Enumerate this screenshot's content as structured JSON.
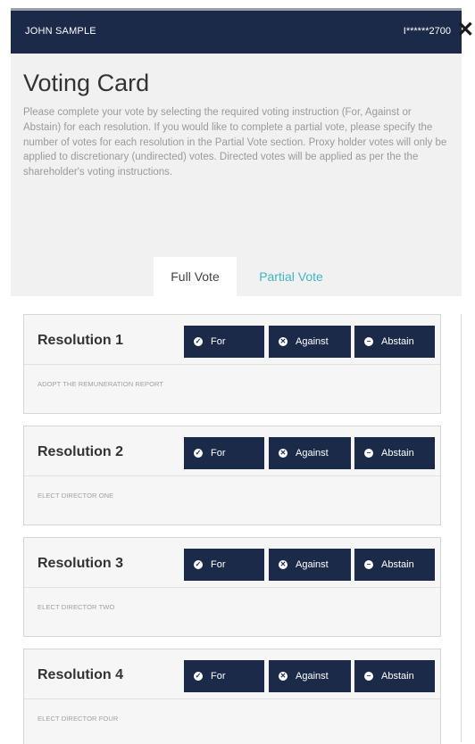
{
  "header": {
    "user_name": "JOHN SAMPLE",
    "account_masked": "I******2700"
  },
  "close_label": "✕",
  "title": "Voting Card",
  "intro": "Please complete your vote by selecting the required voting instruction (For, Against or Abstain) for each resolution. If you would like to complete a partial vote, please specify the number of votes for each resolution in the Partial Vote section. Proxy holder votes will only be applied to discretionary (undirected) votes. Directed votes will be applied as per the the shareholder's voting instructions.",
  "tabs": {
    "full": "Full Vote",
    "partial": "Partial Vote"
  },
  "buttons": {
    "for": "For",
    "against": "Against",
    "abstain": "Abstain"
  },
  "resolutions": [
    {
      "label": "Resolution 1",
      "description": "ADOPT THE REMUNERATION REPORT"
    },
    {
      "label": "Resolution 2",
      "description": "ELECT DIRECTOR ONE"
    },
    {
      "label": "Resolution 3",
      "description": "ELECT DIRECTOR TWO"
    },
    {
      "label": "Resolution 4",
      "description": "ELECT DIRECTOR FOUR"
    }
  ],
  "colors": {
    "navy": "#1c2a4a",
    "tab_accent": "#3fb6c4"
  },
  "icons": {
    "for": "check-circle-icon",
    "against": "x-circle-icon",
    "abstain": "minus-circle-icon"
  }
}
